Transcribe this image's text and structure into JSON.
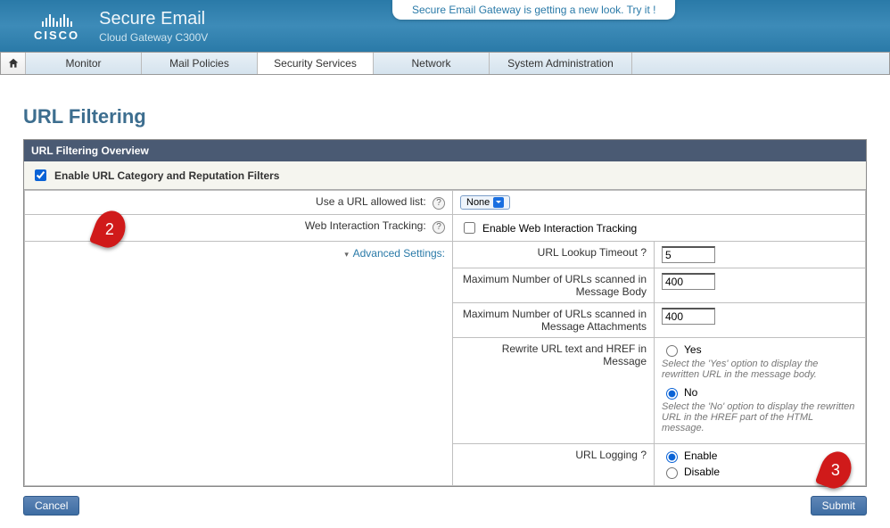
{
  "banner": {
    "brand": "CISCO",
    "product": "Secure Email",
    "subproduct": "Cloud Gateway C300V",
    "try_text": "Secure Email Gateway is getting a new look. Try it !"
  },
  "nav": {
    "tabs": [
      "Monitor",
      "Mail Policies",
      "Security Services",
      "Network",
      "System Administration"
    ],
    "active_index": 2
  },
  "page": {
    "title": "URL Filtering",
    "panel_title": "URL Filtering Overview",
    "enable_label": "Enable URL Category and Reputation Filters",
    "enable_checked": true
  },
  "rows": {
    "allowed_list_label": "Use a URL allowed list:",
    "allowed_list_value": "None",
    "web_tracking_label": "Web Interaction Tracking:",
    "web_tracking_checkbox_label": "Enable Web Interaction Tracking",
    "advanced_label": "Advanced Settings:"
  },
  "adv": {
    "lookup_label": "URL Lookup Timeout",
    "lookup_value": "5",
    "max_body_label": "Maximum Number of URLs scanned in Message Body",
    "max_body_value": "400",
    "max_attach_label": "Maximum Number of URLs scanned in Message Attachments",
    "max_attach_value": "400",
    "rewrite_label": "Rewrite URL text and HREF in Message",
    "rewrite_yes": "Yes",
    "rewrite_yes_hint": "Select the 'Yes' option to display the rewritten URL in the message body.",
    "rewrite_no": "No",
    "rewrite_no_hint": "Select the 'No' option to display the rewritten URL in the HREF part of the HTML message.",
    "logging_label": "URL Logging",
    "logging_enable": "Enable",
    "logging_disable": "Disable"
  },
  "buttons": {
    "cancel": "Cancel",
    "submit": "Submit"
  },
  "annotations": {
    "b2": "2",
    "b3": "3"
  }
}
